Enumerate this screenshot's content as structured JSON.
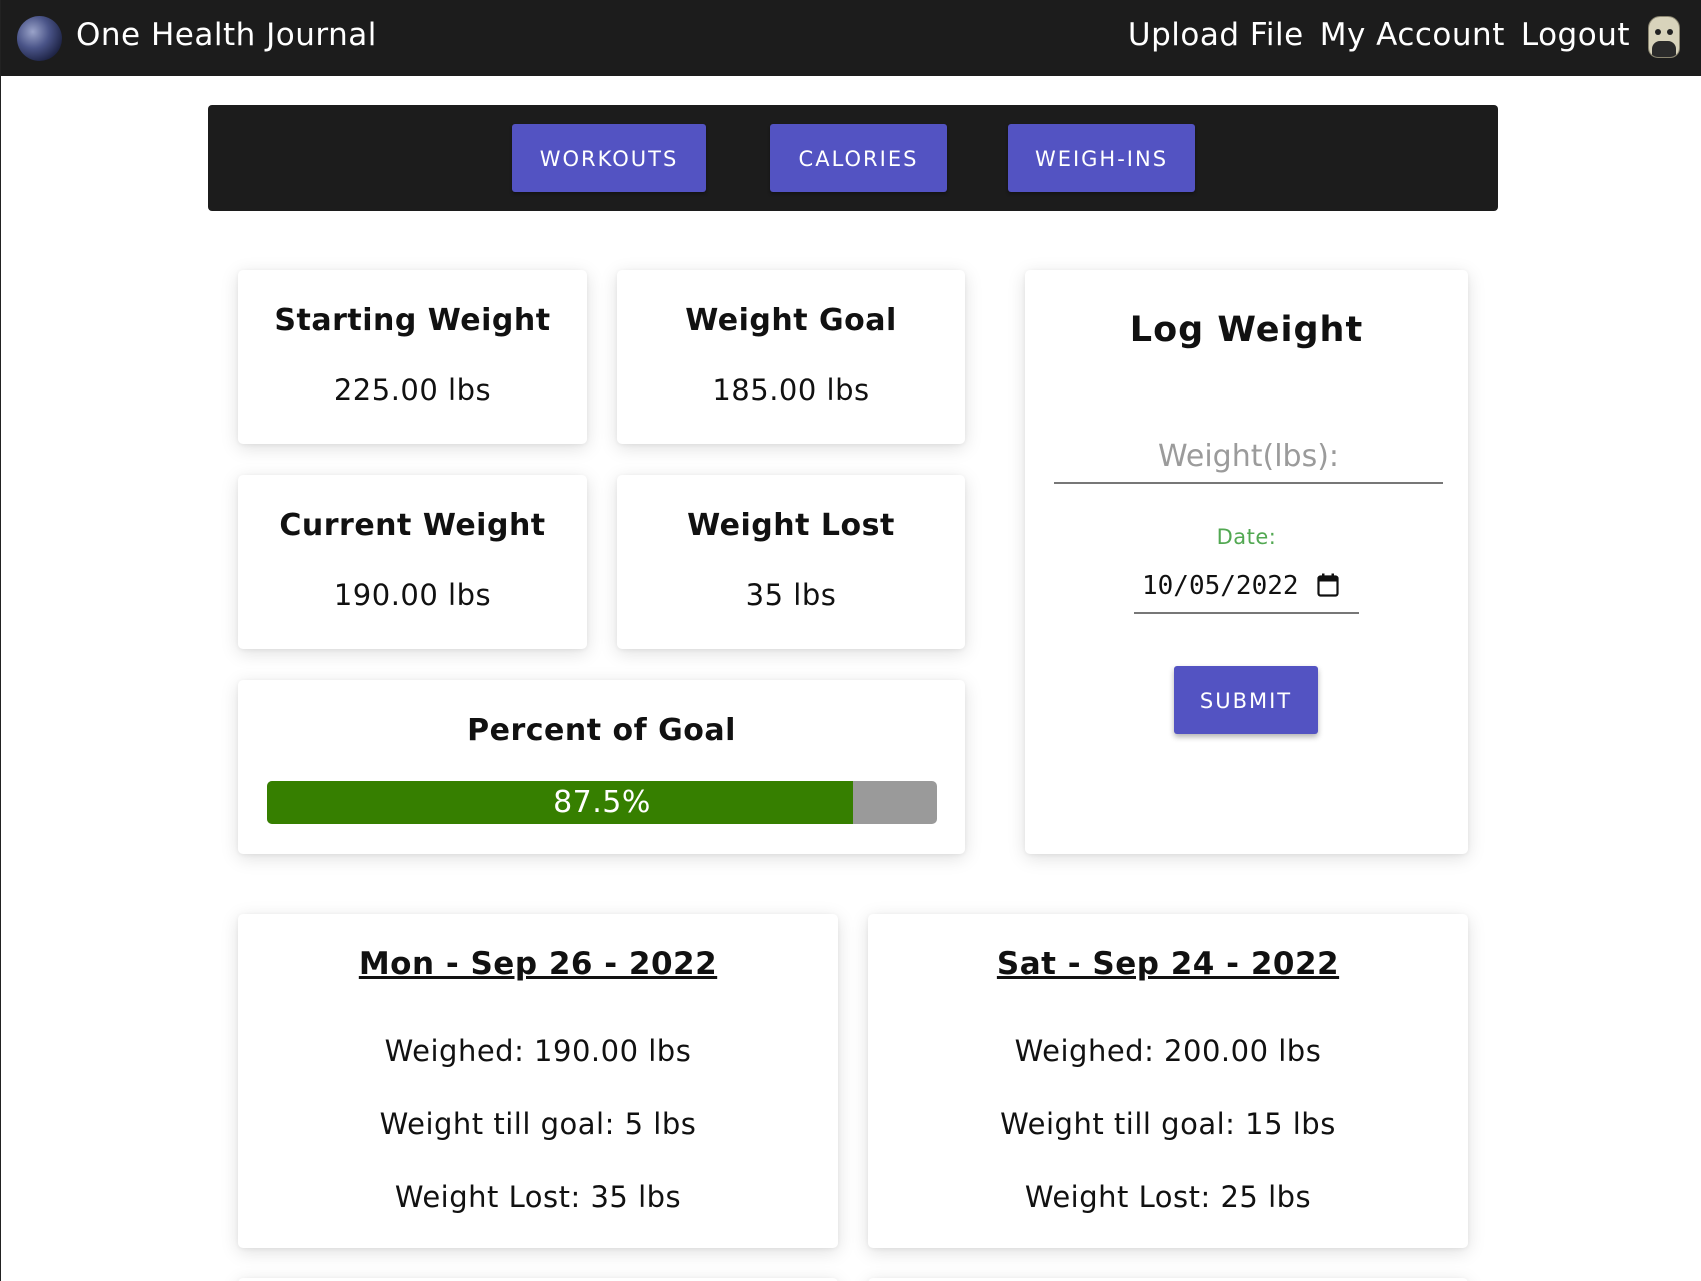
{
  "navbar": {
    "app_title": "One Health Journal",
    "logo_icon": "globe-icon",
    "links": [
      "Upload File",
      "My Account",
      "Logout"
    ],
    "avatar_icon": "avatar-icon"
  },
  "tabs": [
    "WORKOUTS",
    "CALORIES",
    "WEIGH-INS"
  ],
  "stats": {
    "starting": {
      "title": "Starting Weight",
      "value": "225.00 lbs"
    },
    "goal": {
      "title": "Weight Goal",
      "value": "185.00 lbs"
    },
    "current": {
      "title": "Current Weight",
      "value": "190.00 lbs"
    },
    "lost": {
      "title": "Weight Lost",
      "value": "35 lbs"
    }
  },
  "progress": {
    "title": "Percent of Goal",
    "label": "87.5%",
    "fraction": 0.875,
    "fill_color": "#367f00",
    "track_color": "#9a9a9a"
  },
  "log_form": {
    "title": "Log Weight",
    "weight_placeholder": "Weight(lbs):",
    "weight_value": "",
    "date_label": "Date:",
    "date_value": "10/05/2022",
    "date_icon": "calendar-icon",
    "submit_label": "SUBMIT"
  },
  "history": [
    {
      "date": "Mon - Sep 26 - 2022",
      "weighed": "Weighed: 190.00 lbs",
      "till_goal": "Weight till goal: 5 lbs",
      "lost": "Weight Lost: 35 lbs"
    },
    {
      "date": "Sat - Sep 24 - 2022",
      "weighed": "Weighed: 200.00 lbs",
      "till_goal": "Weight till goal: 15 lbs",
      "lost": "Weight Lost: 25 lbs"
    }
  ],
  "colors": {
    "navbar": "#1c1c1c",
    "button": "#5353c2",
    "date_label": "#52a852"
  }
}
